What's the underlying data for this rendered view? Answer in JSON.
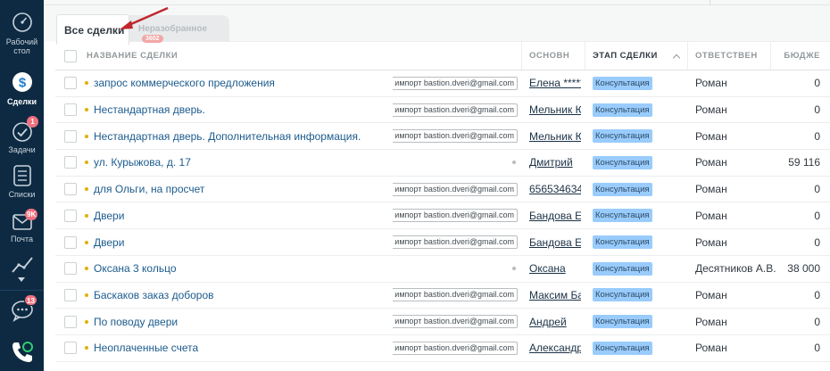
{
  "sidebar": {
    "items": [
      {
        "label_line1": "Рабочий",
        "label_line2": "стол",
        "icon": "dashboard-icon"
      },
      {
        "label": "Сделки",
        "icon": "leads-icon",
        "active": true
      },
      {
        "label": "Задачи",
        "icon": "tasks-icon",
        "badge": "1"
      },
      {
        "label": "Списки",
        "icon": "lists-icon"
      },
      {
        "label": "Почта",
        "icon": "mail-icon",
        "badge": "9K"
      },
      {
        "label": "",
        "icon": "stats-icon"
      },
      {
        "label": "",
        "icon": "chat-icon",
        "badge": "13"
      },
      {
        "label": "",
        "icon": "phone-icon"
      }
    ]
  },
  "tabs": {
    "active": "Все сделки",
    "inactive": "Неразобранное",
    "inactive_count": "3602"
  },
  "table": {
    "headers": {
      "name": "Название сделки",
      "contact": "Основн",
      "stage": "Этап сделки",
      "responsible": "Ответствен",
      "budget": "Бюдже"
    },
    "rows": [
      {
        "name": "запрос коммерческого предложения",
        "tag": "импорт bastion.dveri@gmail.com",
        "contact": "Елена ******",
        "stage": "Консультация",
        "responsible": "Роман",
        "budget": "0"
      },
      {
        "name": "Нестандартная дверь.",
        "tag": "импорт bastion.dveri@gmail.com",
        "contact": "Мельник Ю",
        "stage": "Консультация",
        "responsible": "Роман",
        "budget": "0"
      },
      {
        "name": "Нестандартная дверь. Дополнительная информация.",
        "tag": "импорт bastion.dveri@gmail.com",
        "contact": "Мельник Ю",
        "stage": "Консультация",
        "responsible": "Роман",
        "budget": "0"
      },
      {
        "name": "ул. Курыжова, д. 17",
        "tag": "",
        "contact": "Дмитрий",
        "stage": "Консультация",
        "responsible": "Роман",
        "budget": "59 116"
      },
      {
        "name": "для Ольги, на просчет",
        "tag": "импорт bastion.dveri@gmail.com",
        "contact": "656534634",
        "stage": "Консультация",
        "responsible": "Роман",
        "budget": "0"
      },
      {
        "name": "Двери",
        "tag": "импорт bastion.dveri@gmail.com",
        "contact": "Бандова Ев",
        "stage": "Консультация",
        "responsible": "Роман",
        "budget": "0"
      },
      {
        "name": "Двери",
        "tag": "импорт bastion.dveri@gmail.com",
        "contact": "Бандова Ев",
        "stage": "Консультация",
        "responsible": "Роман",
        "budget": "0"
      },
      {
        "name": "Оксана 3 кольцо",
        "tag": "",
        "contact": "Оксана",
        "stage": "Консультация",
        "responsible": "Десятников А.В.",
        "budget": "38 000"
      },
      {
        "name": "Баскаков заказ доборов",
        "tag": "импорт bastion.dveri@gmail.com",
        "contact": "Максим Бас",
        "stage": "Консультация",
        "responsible": "Роман",
        "budget": "0"
      },
      {
        "name": "По поводу двери",
        "tag": "импорт bastion.dveri@gmail.com",
        "contact": "Андрей",
        "stage": "Консультация",
        "responsible": "Роман",
        "budget": "0"
      },
      {
        "name": "Неоплаченные счета",
        "tag": "импорт bastion.dveri@gmail.com",
        "contact": "Александр",
        "stage": "Консультация",
        "responsible": "Роман",
        "budget": "0"
      }
    ]
  },
  "colors": {
    "sidebar_bg": "#0d2a42",
    "stage_bg": "#99ccfd",
    "link": "#1c5b8d",
    "annotation_arrow": "#c0272d"
  }
}
